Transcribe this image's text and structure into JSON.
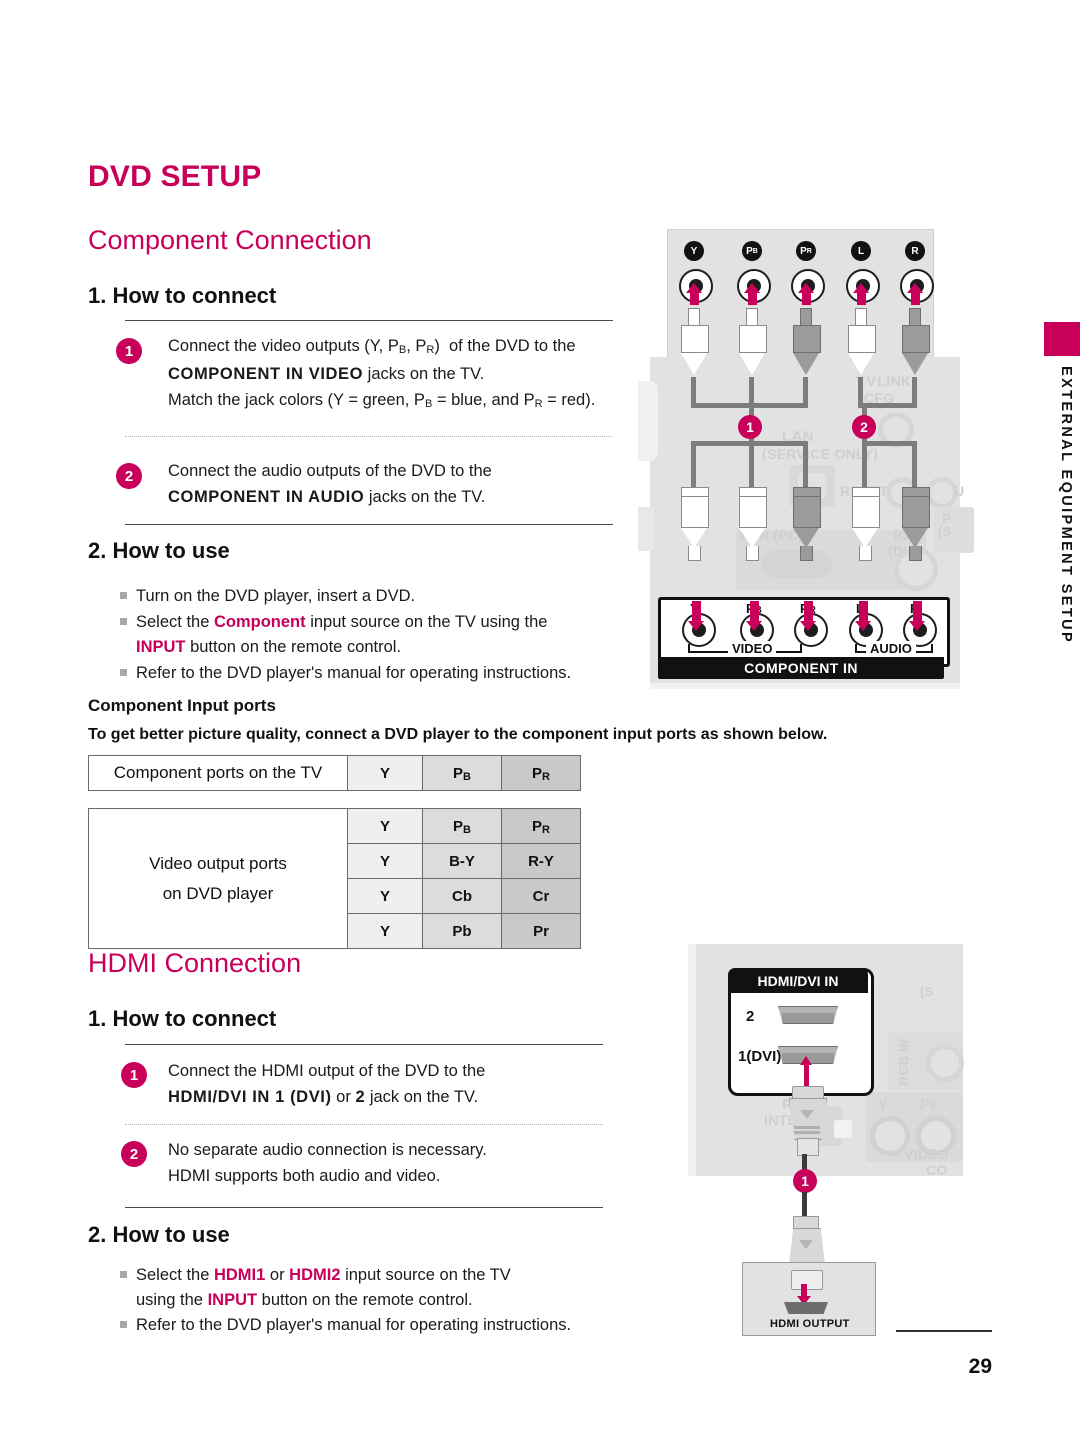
{
  "chapter_title": "DVD SETUP",
  "side_tab_label": "EXTERNAL EQUIPMENT SETUP",
  "page_number": "29",
  "component": {
    "section_title": "Component Connection",
    "step1_heading": "1. How to connect",
    "step1_items": [
      {
        "num": "1",
        "line1_pre": "Connect the video outputs (Y, P",
        "line1_sub1": "B",
        "line1_mid": ", P",
        "line1_sub2": "R",
        "line1_post": ")  of the DVD to the",
        "line2_bold": "COMPONENT IN VIDEO",
        "line2_rest": "jacks on the TV.",
        "line3": "Match the jack colors (Y = green, PB = blue, and PR = red)."
      },
      {
        "num": "2",
        "line1": "Connect the audio outputs of the DVD to the",
        "line2_bold": "COMPONENT IN AUDIO",
        "line2_rest": "jacks on the TV."
      }
    ],
    "step2_heading": "2. How to use",
    "step2_bullets": [
      "Turn on the DVD player, insert a DVD.",
      "Select the Component input source on the TV using the INPUT button on the remote control.",
      "Refer to the DVD player's manual for operating instructions."
    ],
    "bullet2_parts": {
      "a": "Select the ",
      "hi1": "Component",
      "b": " input source on the TV using the",
      "hi2": "INPUT",
      "c": " button on the remote control."
    },
    "ports_heading": "Component Input ports",
    "ports_lead": "To get better picture quality, connect a DVD player to the component input ports as shown below.",
    "table_tv": {
      "label": "Component ports on the TV",
      "cells": [
        "Y",
        "PB",
        "PR"
      ]
    },
    "table_dvd": {
      "label_line1": "Video output ports",
      "label_line2": "on DVD player",
      "rows": [
        [
          "Y",
          "PB",
          "PR"
        ],
        [
          "Y",
          "B-Y",
          "R-Y"
        ],
        [
          "Y",
          "Cb",
          "Cr"
        ],
        [
          "Y",
          "Pb",
          "Pr"
        ]
      ]
    },
    "diagram": {
      "dvd_jack_labels": [
        "Y",
        "PB",
        "PR",
        "L",
        "R"
      ],
      "tv_jack_labels": [
        "Y",
        "PB",
        "PR",
        "L",
        "R"
      ],
      "panel_title": "COMPONENT IN",
      "group_video": "VIDEO",
      "group_audio": "AUDIO",
      "callouts": [
        "1",
        "2"
      ],
      "background_labels": [
        "TV LINK CFG",
        "LAN",
        "(SERVICE ONLY)",
        "RESET",
        "U",
        "RGB IN (PC)",
        "AUDIO (DVI)",
        "P (S"
      ]
    }
  },
  "hdmi": {
    "section_title": "HDMI Connection",
    "step1_heading": "1. How to connect",
    "step1_items": [
      {
        "num": "1",
        "line1": "Connect the HDMI output of the DVD to the",
        "line2_bold_a": "HDMI/DVI IN 1 (DVI)",
        "line2_or": "or",
        "line2_bold_b": "2",
        "line2_rest": "jack on the TV."
      },
      {
        "num": "2",
        "line1": "No separate audio connection is necessary.",
        "line2": "HDMI supports both audio and video."
      }
    ],
    "step2_heading": "2. How to use",
    "step2_bullets": [
      "Select the HDMI1 or HDMI2 input source on the TV using the INPUT button on the remote control.",
      "Refer to the DVD player's manual for operating instructions."
    ],
    "bullet1_parts": {
      "a": "Select the ",
      "hi1": "HDMI1",
      "b": " or ",
      "hi2": "HDMI2",
      "c": " input source on the TV",
      "d": "using the ",
      "hi3": "INPUT",
      "e": " button on the remote control."
    },
    "diagram": {
      "panel_title": "HDMI/DVI IN",
      "port2_label": "2",
      "port1_label": "1(DVI)",
      "callout": "1",
      "device_label": "HDMI OUTPUT",
      "background_labels": [
        "RJP",
        "INTERFACE",
        "RGB IN",
        "Y",
        "PB",
        "VIDEO",
        "CO",
        "(S"
      ]
    }
  },
  "colors": {
    "accent": "#C8005A",
    "panel_gray": "#E2E2E2",
    "table_light": "#EFEFEF",
    "table_mid": "#DCDCDC",
    "table_dark": "#C9C9C9"
  }
}
